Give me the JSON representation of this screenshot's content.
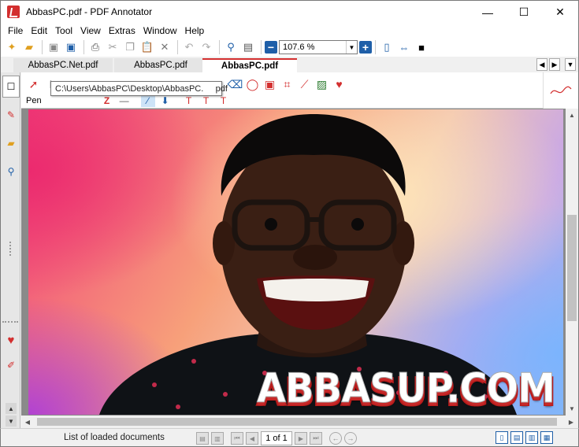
{
  "window": {
    "title": "AbbasPC.pdf - PDF Annotator",
    "minimize": "—",
    "maximize": "☐",
    "close": "✕"
  },
  "menu": [
    "File",
    "Edit",
    "Tool",
    "View",
    "Extras",
    "Window",
    "Help"
  ],
  "toolbar": {
    "zoom_value": "107.6 %",
    "zoom_minus": "−",
    "zoom_plus": "+"
  },
  "tabs": [
    {
      "label": "AbbasPC.Net.pdf",
      "active": false
    },
    {
      "label": "AbbasPC.pdf",
      "active": false
    },
    {
      "label": "AbbasPC.pdf",
      "active": true
    }
  ],
  "tooltip": "C:\\Users\\AbbasPC\\Desktop\\AbbasPC.     pdf",
  "annotation": {
    "pen_label": "Pen"
  },
  "document": {
    "watermark": "ABBASUP.COM"
  },
  "status": {
    "text": "List of loaded documents",
    "page": "1 of 1"
  },
  "colors": {
    "accent": "#d32f2f",
    "blue": "#1f5fa8"
  }
}
